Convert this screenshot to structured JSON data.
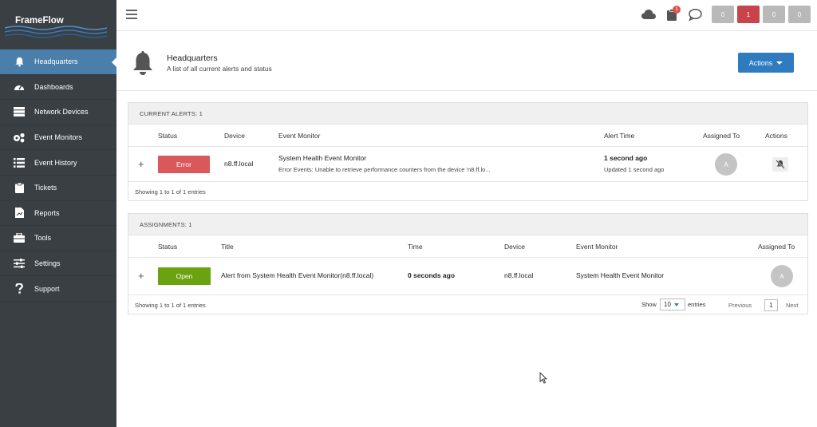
{
  "app": {
    "name": "FrameFlow"
  },
  "sidebar": {
    "items": [
      {
        "label": "Headquarters",
        "icon": "bell-icon",
        "active": true
      },
      {
        "label": "Dashboards",
        "icon": "dashboard-gauge-icon"
      },
      {
        "label": "Network Devices",
        "icon": "server-icon"
      },
      {
        "label": "Event Monitors",
        "icon": "gears-icon"
      },
      {
        "label": "Event History",
        "icon": "list-icon"
      },
      {
        "label": "Tickets",
        "icon": "clipboard-icon"
      },
      {
        "label": "Reports",
        "icon": "report-file-icon"
      },
      {
        "label": "Tools",
        "icon": "toolbox-icon"
      },
      {
        "label": "Settings",
        "icon": "sliders-icon"
      },
      {
        "label": "Support",
        "icon": "question-icon"
      }
    ]
  },
  "topbar": {
    "clipboard_badge": "1",
    "counts": [
      "0",
      "1",
      "0",
      "0"
    ],
    "count_colors": [
      "#b9b9b9",
      "#c9434a",
      "#b9b9b9",
      "#b9b9b9"
    ]
  },
  "header": {
    "title": "Headquarters",
    "subtitle": "A list of all current alerts and status",
    "actions_label": "Actions"
  },
  "alerts": {
    "heading": "CURRENT ALERTS: 1",
    "columns": [
      "Status",
      "Device",
      "Event Monitor",
      "Alert Time",
      "Assigned To",
      "Actions"
    ],
    "rows": [
      {
        "status": "Error",
        "device": "n8.ff.local",
        "monitor": "System Health Event Monitor",
        "detail": "Error Events: Unable to retrieve performance counters from the device 'n8.ff.lo...",
        "time": "1 second ago",
        "updated": "Updated 1 second ago",
        "assigned": "A"
      }
    ],
    "footer": "Showing 1 to 1 of 1 entries"
  },
  "assignments": {
    "heading": "ASSIGNMENTS: 1",
    "columns": [
      "Status",
      "Title",
      "Time",
      "Device",
      "Event Monitor",
      "Assigned To"
    ],
    "rows": [
      {
        "status": "Open",
        "title": "Alert from System Health Event Monitor(n8.ff.local)",
        "time": "0 seconds ago",
        "device": "n8.ff.local",
        "monitor": "System Health Event Monitor",
        "assigned": "A"
      }
    ],
    "footer": "Showing 1 to 1 of 1 entries",
    "show_label": "Show",
    "page_size": "10",
    "entries_label": "entries",
    "prev_label": "Previous",
    "page": "1",
    "next_label": "Next"
  },
  "colors": {
    "sidebar_bg": "#3a3f44",
    "active_nav": "#4a7fac",
    "primary": "#2e7bc0",
    "error": "#d9585a",
    "open": "#6aa30f"
  }
}
